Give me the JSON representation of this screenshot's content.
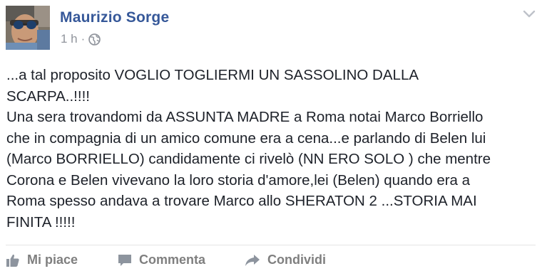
{
  "post": {
    "author": "Maurizio Sorge",
    "time": "1 h",
    "separator": "·",
    "audience_icon": "globe-icon",
    "menu_icon": "chevron-down-icon",
    "text": "...a tal proposito VOGLIO TOGLIERMI UN SASSOLINO DALLA\nSCARPA..!!!!\nUna sera trovandomi da ASSUNTA MADRE a Roma notai Marco Borriello\nche in compagnia di un amico comune era a cena...e parlando di Belen lui\n(Marco BORRIELLO) candidamente ci rivelò (NN ERO SOLO ) che mentre\nCorona e Belen vivevano la loro storia d'amore,lei (Belen) quando era a\nRoma spesso andava a trovare Marco allo SHERATON 2 ...STORIA MAI\nFINITA !!!!!"
  },
  "actions": {
    "like_label": "Mi piace",
    "comment_label": "Commenta",
    "share_label": "Condividi",
    "like_icon": "thumbs-up-icon",
    "comment_icon": "speech-bubble-icon",
    "share_icon": "share-arrow-icon"
  },
  "colors": {
    "author": "#365899",
    "meta": "#90949c",
    "text": "#1d2129",
    "action": "#7f7f7f"
  }
}
